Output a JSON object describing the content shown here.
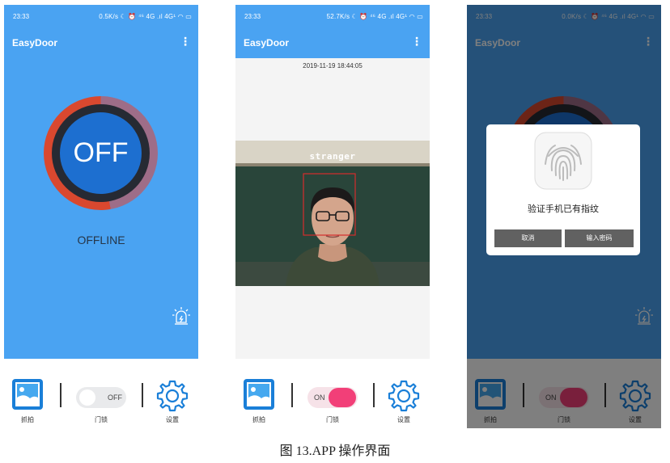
{
  "status_bar": {
    "phone1": {
      "time": "23:33",
      "indicators": "0.5K/s ☾ ⏰ ⁴⁶ 4G .ıl 4G¹ ◠ ▭"
    },
    "phone2": {
      "time": "23:33",
      "indicators": "52.7K/s ☾ ⏰ ⁴⁶ 4G .ıl 4G¹ ◠ ▭"
    },
    "phone3": {
      "time": "23:33",
      "indicators": "0.0K/s ☾ ⏰ ⁴⁶ 4G .ıl 4G¹ ◠ ▭"
    }
  },
  "app": {
    "title": "EasyDoor",
    "menu_icon": "more-vert-icon"
  },
  "lock_status": {
    "button_label": "OFF",
    "status_text": "OFFLINE",
    "alarm_icon": "alarm-siren-icon"
  },
  "camera": {
    "timestamp": "2019-11-19 18:44:05",
    "face_label": "stranger"
  },
  "bottom_nav": {
    "capture_label": "抓拍",
    "lock_label": "门锁",
    "settings_label": "设置",
    "toggle_off_label": "OFF",
    "toggle_on_label": "ON"
  },
  "fingerprint_dialog": {
    "message": "验证手机已有指纹",
    "cancel_label": "取消",
    "password_label": "输入密码"
  },
  "caption": "图 13.APP 操作界面",
  "colors": {
    "primary": "#4aa3f2",
    "toggle_on": "#f23f78",
    "ring_red": "#d9482f",
    "button_blue": "#1d6fd0"
  }
}
